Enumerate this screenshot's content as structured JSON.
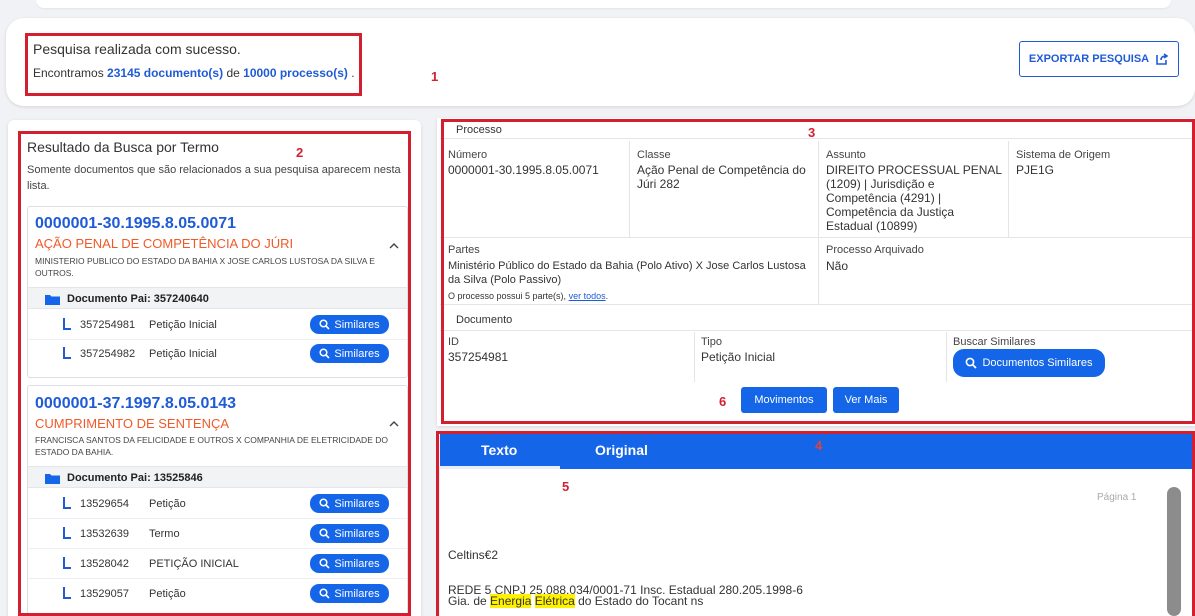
{
  "summary": {
    "title": "Pesquisa realizada com sucesso.",
    "found_prefix": "Encontramos",
    "documents": "23145 documento(s)",
    "connector": "de",
    "processes": "10000 processo(s)",
    "suffix": "."
  },
  "export_button": "EXPORTAR PESQUISA",
  "annotations": [
    "1",
    "2",
    "3",
    "4",
    "5",
    "6"
  ],
  "results": {
    "title": "Resultado da Busca por Termo",
    "description": "Somente documentos que são relacionados a sua pesquisa aparecem nesta lista.",
    "processes": [
      {
        "number": "0000001-30.1995.8.05.0071",
        "class": "AÇÃO PENAL DE COMPETÊNCIA DO JÚRI",
        "parties": "MINISTERIO PUBLICO DO ESTADO DA BAHIA X JOSE CARLOS LUSTOSA DA SILVA E OUTROS.",
        "parent_doc": "Documento Pai: 357240640",
        "docs": [
          {
            "id": "357254981",
            "type": "Petição Inicial"
          },
          {
            "id": "357254982",
            "type": "Petição Inicial"
          }
        ]
      },
      {
        "number": "0000001-37.1997.8.05.0143",
        "class": "CUMPRIMENTO DE SENTENÇA",
        "parties": "FRANCISCA SANTOS DA FELICIDADE E OUTROS X COMPANHIA DE ELETRICIDADE DO ESTADO DA BAHIA.",
        "parent_doc": "Documento Pai: 13525846",
        "docs": [
          {
            "id": "13529654",
            "type": "Petição"
          },
          {
            "id": "13532639",
            "type": "Termo"
          },
          {
            "id": "13528042",
            "type": "PETIÇÃO INICIAL"
          },
          {
            "id": "13529057",
            "type": "Petição"
          }
        ]
      }
    ],
    "similar_label": "Similares"
  },
  "process_detail": {
    "section_title": "Processo",
    "numero_label": "Número",
    "numero": "0000001-30.1995.8.05.0071",
    "classe_label": "Classe",
    "classe": "Ação Penal de Competência do Júri 282",
    "assunto_label": "Assunto",
    "assunto": "DIREITO PROCESSUAL PENAL (1209) | Jurisdição e Competência (4291) | Competência da Justiça Estadual (10899)",
    "sistema_label": "Sistema de Origem",
    "sistema": "PJE1G",
    "partes_label": "Partes",
    "partes": "Ministério Público do Estado da Bahia (Polo Ativo) X Jose Carlos Lustosa da Silva (Polo Passivo)",
    "partes_note": "O processo possui 5 parte(s),",
    "partes_link": "ver todos",
    "arquivado_label": "Processo Arquivado",
    "arquivado": "Não",
    "doc_section_title": "Documento",
    "id_label": "ID",
    "id": "357254981",
    "tipo_label": "Tipo",
    "tipo": "Petição Inicial",
    "buscar_label": "Buscar Similares",
    "buscar_button": "Documentos Similares",
    "movimentos_button": "Movimentos",
    "ver_mais_button": "Ver Mais"
  },
  "viewer": {
    "tabs": [
      "Texto",
      "Original"
    ],
    "page_label": "Página 1",
    "lines": {
      "l1": "Celtins€2",
      "l2": "REDE 5 CNPJ 25.088.034/0001-71 Insc. Estadual 280.205.1998-6",
      "l3_pre": "Gia. de",
      "l3_hl1": "Energia",
      "l3_hl2": "Elétrica",
      "l3_post": "do Estado do Tocant ns"
    }
  }
}
